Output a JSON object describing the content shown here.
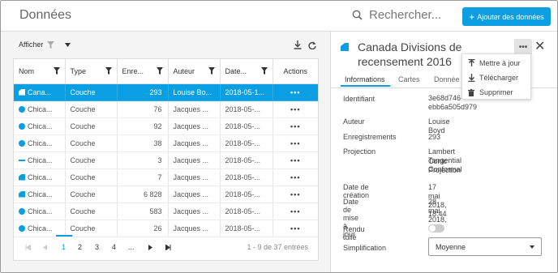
{
  "header": {
    "title": "Données",
    "search_placeholder": "Rechercher...",
    "add_button": "Ajouter des données"
  },
  "toolbar": {
    "show_label": "Afficher"
  },
  "table": {
    "headers": [
      "Nom",
      "Type",
      "Enre...",
      "Auteur",
      "Date...",
      "Actions"
    ],
    "rows": [
      {
        "icon": "polygon",
        "name": "Cana...",
        "type": "Couche",
        "count": "293",
        "author": "Louise Bo...",
        "date": "2018-05-1...",
        "selected": true
      },
      {
        "icon": "point",
        "name": "Chica...",
        "type": "Couche",
        "count": "76",
        "author": "Jacques ...",
        "date": "2018-05-...",
        "selected": false
      },
      {
        "icon": "point",
        "name": "Chica...",
        "type": "Couche",
        "count": "92",
        "author": "Jacques ...",
        "date": "2018-05-...",
        "selected": false
      },
      {
        "icon": "point",
        "name": "Chica...",
        "type": "Couche",
        "count": "38",
        "author": "Jacques ...",
        "date": "2018-05-...",
        "selected": false
      },
      {
        "icon": "line",
        "name": "Chica...",
        "type": "Couche",
        "count": "3",
        "author": "Jacques ...",
        "date": "2018-05-...",
        "selected": false
      },
      {
        "icon": "polygon",
        "name": "Chica...",
        "type": "Couche",
        "count": "7",
        "author": "Jacques ...",
        "date": "2018-05-...",
        "selected": false
      },
      {
        "icon": "polygon",
        "name": "Chica...",
        "type": "Couche",
        "count": "6 828",
        "author": "Jacques ...",
        "date": "2018-05-...",
        "selected": false
      },
      {
        "icon": "point",
        "name": "Chica...",
        "type": "Couche",
        "count": "583",
        "author": "Jacques ...",
        "date": "2018-05-...",
        "selected": false
      },
      {
        "icon": "point",
        "name": "Chica...",
        "type": "Couche",
        "count": "26",
        "author": "Jacques ...",
        "date": "2018-05-...",
        "selected": false
      }
    ],
    "actions_label": "•••"
  },
  "pager": {
    "pages": [
      "1",
      "2",
      "3",
      "4",
      "..."
    ],
    "current": "1",
    "info": "1 - 9 de 37 entrées"
  },
  "detail": {
    "title": "Canada Divisions de recensement 2016",
    "tabs": [
      "Informations",
      "Cartes",
      "Donnée"
    ],
    "menu": [
      "Mettre à jour",
      "Télécharger",
      "Supprimer"
    ],
    "fields": {
      "id_label": "Identifiant",
      "id_value_1": "3e68d746-",
      "id_value_2": "ebb6a505d979",
      "author_label": "Auteur",
      "author_value": "Louise Boyd",
      "records_label": "Enregistrements",
      "records_value": "293",
      "projection_label": "Projection",
      "projection_value_1": "Lambert Tangential Conformal",
      "projection_value_2": "Conic Projection",
      "created_label": "Date de création",
      "created_value": "17 mai 2018, 18:44",
      "updated_label": "Date de mise à jour",
      "updated_value": "28 mai 2018, 9:44",
      "tiled_label": "Rendu tuilé",
      "simplification_label": "Simplification",
      "simplification_value": "Moyenne"
    }
  },
  "colors": {
    "accent": "#0c9ee0",
    "selected_row": "#0a9fe3"
  }
}
